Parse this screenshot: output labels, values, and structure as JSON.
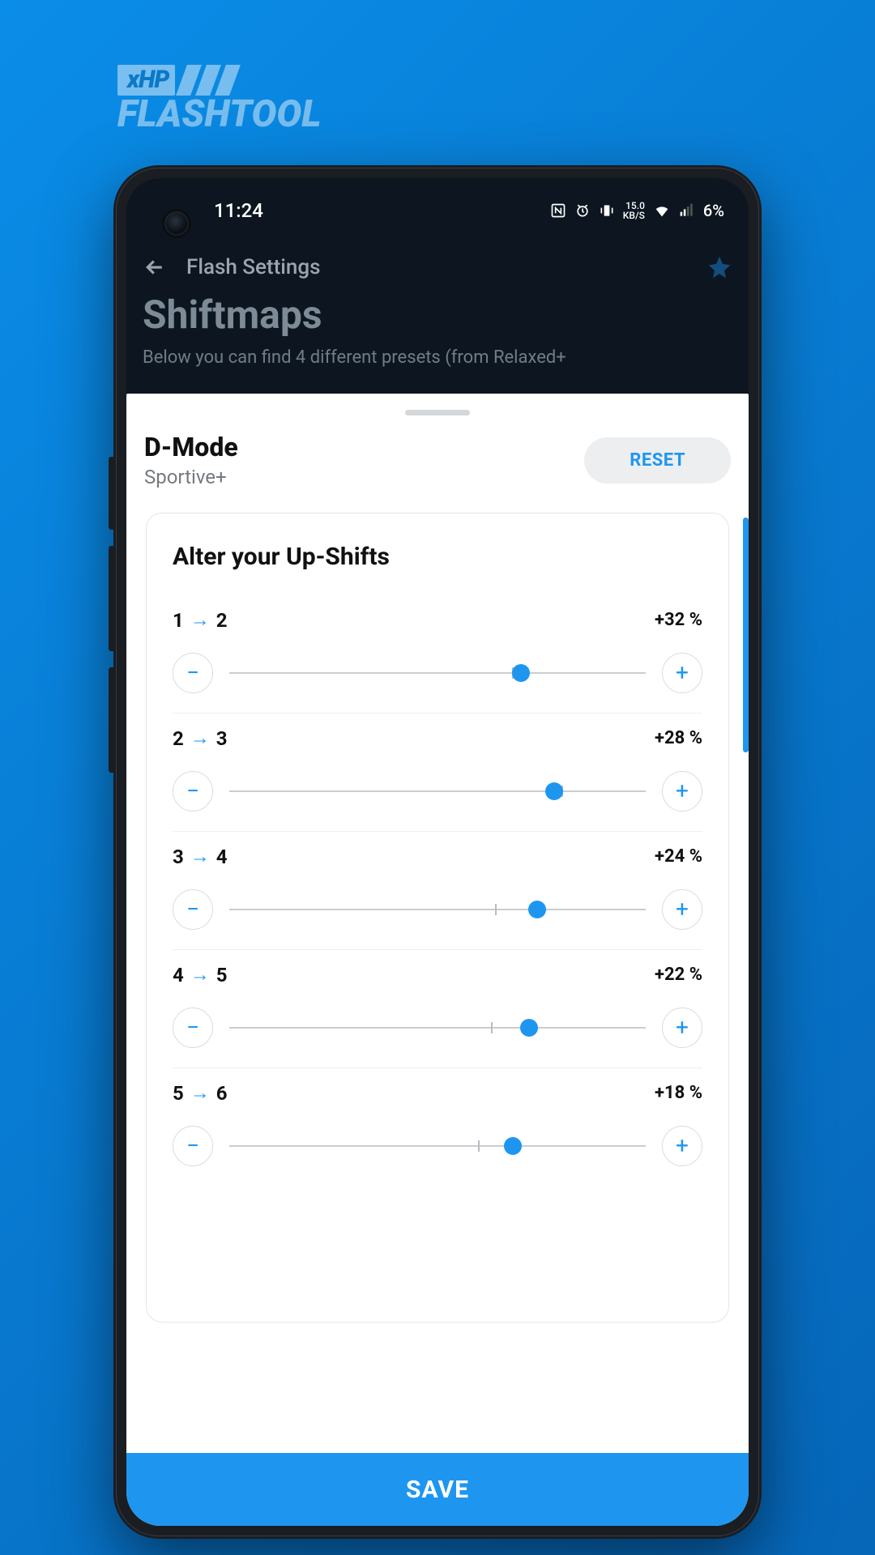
{
  "brand": {
    "xhp": "xHP",
    "tool": "FLASHTOOL"
  },
  "status": {
    "time": "11:24",
    "speed_top": "15.0",
    "speed_bottom": "KB/S",
    "battery": "6%"
  },
  "appbar": {
    "title": "Flash Settings"
  },
  "page": {
    "title": "Shiftmaps",
    "subtitle": "Below you can find 4 different presets (from Relaxed+"
  },
  "sheet": {
    "mode_title": "D-Mode",
    "mode_sub": "Sportive+",
    "reset": "RESET",
    "card_title": "Alter your Up-Shifts",
    "minus": "−",
    "plus": "+",
    "shifts": [
      {
        "from": "1",
        "to": "2",
        "percent": "+32 %",
        "thumb": 70,
        "tick": 68
      },
      {
        "from": "2",
        "to": "3",
        "percent": "+28 %",
        "thumb": 78,
        "tick": 80
      },
      {
        "from": "3",
        "to": "4",
        "percent": "+24 %",
        "thumb": 74,
        "tick": 64
      },
      {
        "from": "4",
        "to": "5",
        "percent": "+22 %",
        "thumb": 72,
        "tick": 63
      },
      {
        "from": "5",
        "to": "6",
        "percent": "+18 %",
        "thumb": 68,
        "tick": 60
      }
    ]
  },
  "save": "SAVE"
}
